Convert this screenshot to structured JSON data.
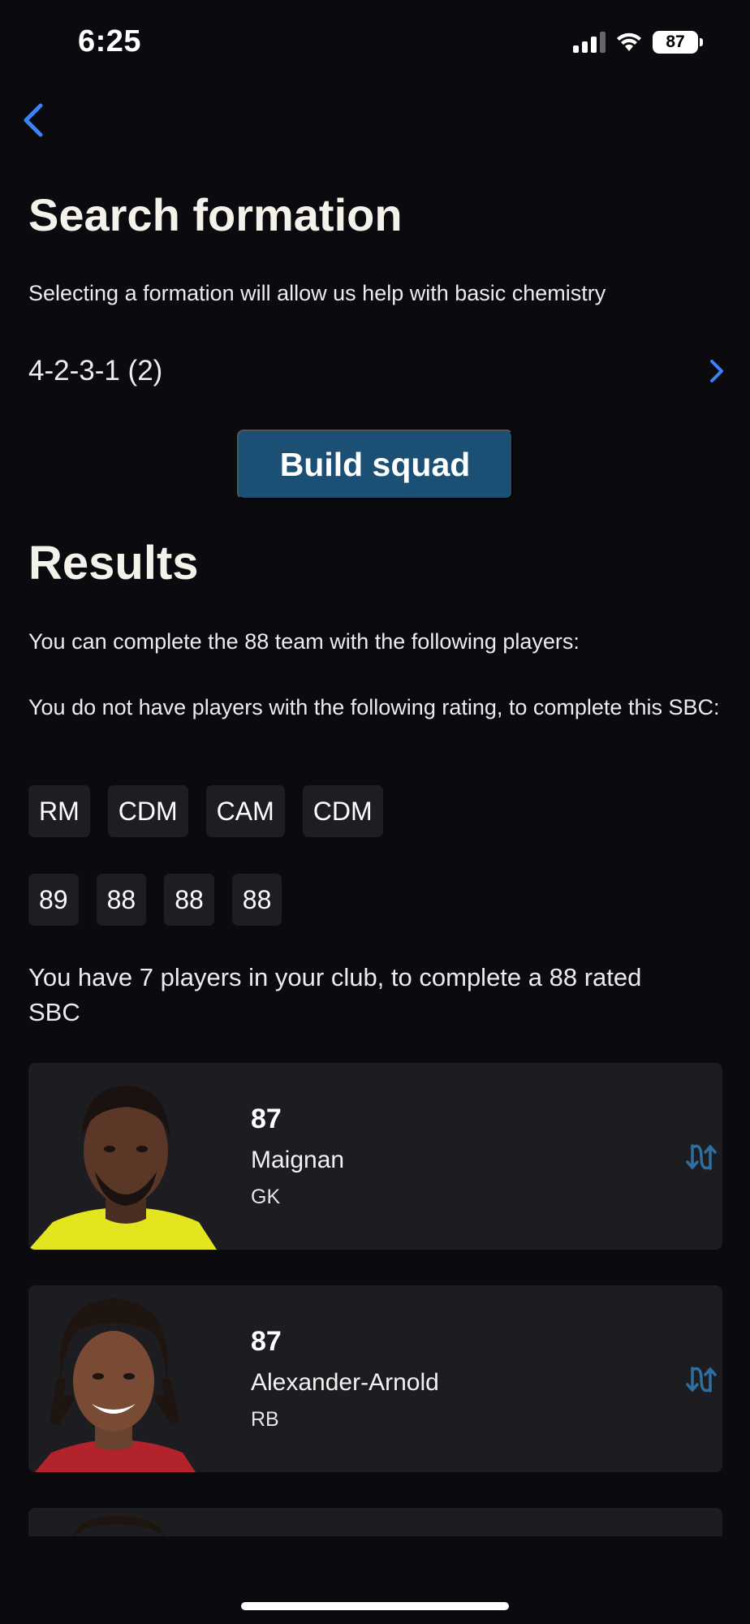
{
  "status": {
    "time": "6:25",
    "battery": "87"
  },
  "nav": {
    "back_icon": "chevron-left-icon"
  },
  "formation": {
    "title": "Search formation",
    "subtitle": "Selecting a formation will allow us help with basic chemistry",
    "value": "4-2-3-1 (2)",
    "build_label": "Build squad"
  },
  "results": {
    "title": "Results",
    "complete_text": "You can complete the 88 team with the following players:",
    "missing_text": "You do not have players with the following rating, to complete this SBC:",
    "positions": [
      "RM",
      "CDM",
      "CAM",
      "CDM"
    ],
    "ratings": [
      "89",
      "88",
      "88",
      "88"
    ],
    "club_text": "You have 7 players in your club, to complete a 88 rated SBC"
  },
  "players": [
    {
      "rating": "87",
      "name": "Maignan",
      "position": "GK",
      "kit_color": "#e3e61f"
    },
    {
      "rating": "87",
      "name": "Alexander-Arnold",
      "position": "RB",
      "kit_color": "#b3232c"
    }
  ],
  "colors": {
    "accent": "#3a82f7",
    "button": "#1b4f74",
    "card": "#1d1d21",
    "swap_icon": "#2f6f9f"
  }
}
